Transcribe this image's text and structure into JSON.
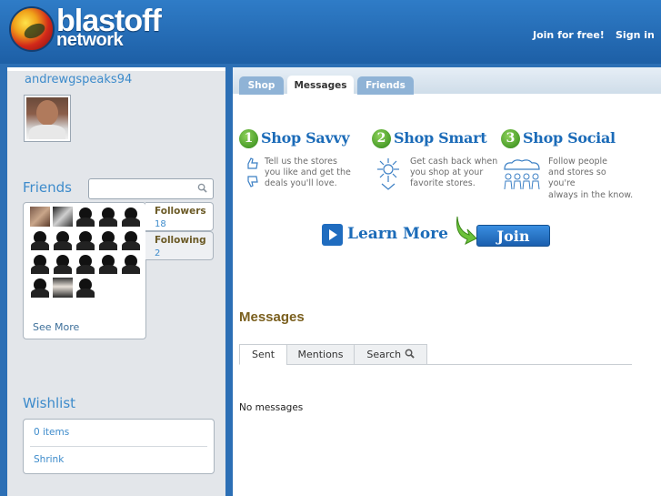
{
  "header": {
    "logo_text": "blastoff",
    "logo_sub": "network",
    "join_link": "Join for free!",
    "signin_link": "Sign in"
  },
  "profile": {
    "username": "andrewgspeaks94"
  },
  "friends": {
    "title": "Friends",
    "search_placeholder": "",
    "see_more": "See More",
    "followers_label": "Followers",
    "followers_count": "18",
    "following_label": "Following",
    "following_count": "2"
  },
  "wishlist": {
    "title": "Wishlist",
    "items": "0 items",
    "shrink": "Shrink"
  },
  "tabs": [
    "Shop",
    "Messages",
    "Friends"
  ],
  "steps": [
    {
      "num": "1",
      "title": "Shop Savvy",
      "desc": [
        "Tell us the stores",
        "you like and get the",
        "deals you'll love."
      ]
    },
    {
      "num": "2",
      "title": "Shop Smart",
      "desc": [
        "Get cash back when",
        "you shop at your",
        "favorite stores."
      ]
    },
    {
      "num": "3",
      "title": "Shop Social",
      "desc": [
        "Follow people",
        "and stores so",
        "you're",
        "always in the know."
      ]
    }
  ],
  "learn_more": "Learn More",
  "join": "Join",
  "messages": {
    "title": "Messages",
    "tabs": [
      "Sent",
      "Mentions",
      "Search"
    ],
    "empty": "No messages"
  },
  "colors": {
    "header_blue": "#2f7cc7",
    "link_blue": "#3d8bcb",
    "heading_brown": "#7a5f1e",
    "step_green": "#4a9d2a"
  }
}
